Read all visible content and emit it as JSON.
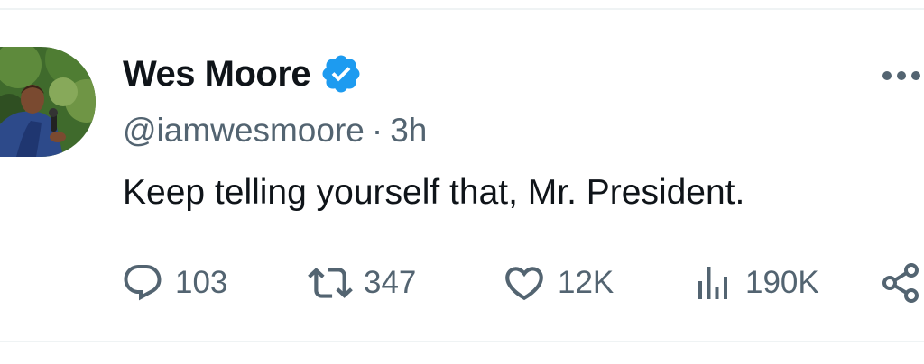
{
  "tweet": {
    "author": {
      "display_name": "Wes Moore",
      "handle": "@iamwesmoore",
      "verified": true
    },
    "separator": "·",
    "time_ago": "3h",
    "text": "Keep telling yourself that, Mr. President.",
    "stats": {
      "replies": "103",
      "retweets": "347",
      "likes": "12K",
      "views": "190K"
    }
  },
  "icons": {
    "verified": "verified-badge-icon",
    "more": "more-dots-icon",
    "reply": "reply-bubble-icon",
    "retweet": "retweet-icon",
    "like": "heart-icon",
    "views": "views-bar-chart-icon",
    "share": "share-icon"
  },
  "colors": {
    "text_primary": "#0f1419",
    "text_secondary": "#536471",
    "verified_blue": "#1d9bf0",
    "divider": "#eff3f4"
  }
}
